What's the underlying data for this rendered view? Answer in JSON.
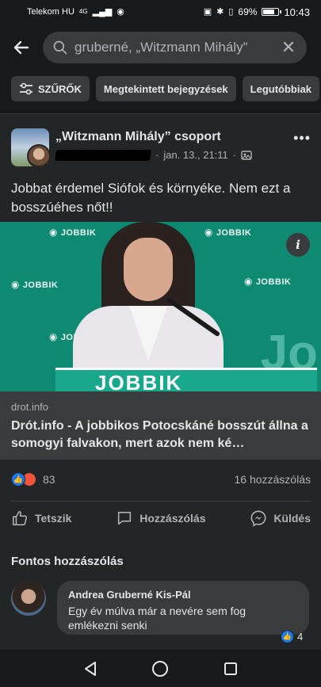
{
  "status_bar": {
    "carrier": "Telekom HU",
    "network": "4G",
    "battery": "69%",
    "battery_level": 0.69,
    "time": "10:43"
  },
  "search": {
    "query": "gruberné, „Witzmann Mihály”"
  },
  "filters": {
    "items": [
      {
        "label": "SZŰRŐK"
      },
      {
        "label": "Megtekintett bejegyzések"
      },
      {
        "label": "Legutóbbiak"
      }
    ]
  },
  "post": {
    "group_name": "„Witzmann Mihály” csoport",
    "date": "jan. 13., 21:11",
    "separator": "·",
    "text": "Jobbat érdemel Siófok és környéke. Nem ezt a bosszúéhes nőt!!",
    "link": {
      "image_brand": "JOBBIK",
      "domain": "drot.info",
      "title": "Drót.info - A jobbikos Potocskáné bosszút állna a somogyi falvakon, mert azok nem ké…"
    },
    "reactions_count": "83",
    "comments_count": "16 hozzászólás",
    "actions": {
      "like": "Tetszik",
      "comment": "Hozzászólás",
      "send": "Küldés"
    },
    "top_comments_heading": "Fontos hozzászólás",
    "comment": {
      "author": "Andrea Gruberné Kis-Pál",
      "text": "Egy év múlva már a nevére sem fog emlékezni senki",
      "reactions": "4"
    }
  },
  "icons": [
    "back-arrow-icon",
    "search-icon",
    "close-icon",
    "filter-sliders-icon",
    "more-options-icon",
    "globe-icon",
    "info-icon",
    "like-reaction-icon",
    "angry-reaction-icon",
    "thumbs-up-icon",
    "comment-icon",
    "messenger-icon",
    "nav-back-icon",
    "nav-home-icon",
    "nav-recents-icon"
  ],
  "colors": {
    "background": "#242526",
    "header": "#18191a",
    "surface": "#3a3b3c",
    "accent_like": "#1877f2",
    "accent_angry": "#f0543b",
    "image_green": "#0e8a72"
  }
}
